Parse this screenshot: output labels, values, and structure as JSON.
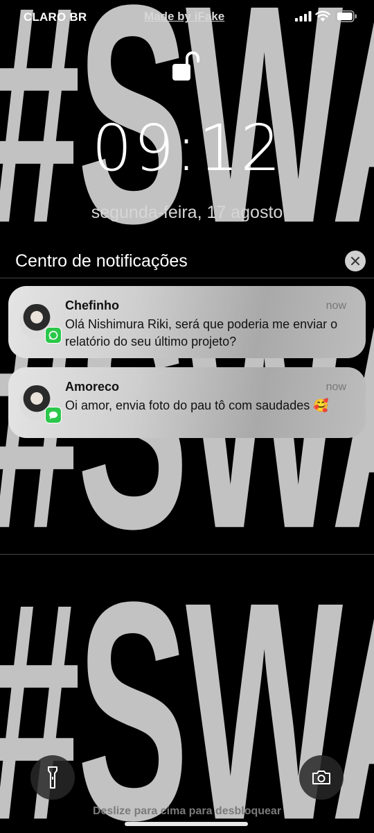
{
  "wallpaper": {
    "text": "#SWAG",
    "color": "#c2c2c2"
  },
  "status": {
    "carrier": "CLARO BR",
    "center": "Made by iFake",
    "icons": [
      "signal-icon",
      "wifi-icon",
      "battery-icon"
    ]
  },
  "lock": {
    "icon": "unlocked-padlock-icon"
  },
  "clock": {
    "time": "09:12",
    "date": "segunda-feira, 17 agosto"
  },
  "notification_center": {
    "title": "Centro de notificações",
    "close_icon": "close-icon"
  },
  "notifications": [
    {
      "sender": "Chefinho",
      "time": "now",
      "app_icon": "whatsapp-icon",
      "message": "Olá Nishimura Riki, será que poderia me enviar o relatório do seu último projeto?"
    },
    {
      "sender": "Amoreco",
      "time": "now",
      "app_icon": "messages-icon",
      "message": "Oi amor, envia foto do pau tô com saudades 🥰"
    }
  ],
  "controls": {
    "left_icon": "flashlight-icon",
    "right_icon": "camera-icon"
  },
  "footer": {
    "swipe_text": "Deslize para cima para desbloquear"
  }
}
